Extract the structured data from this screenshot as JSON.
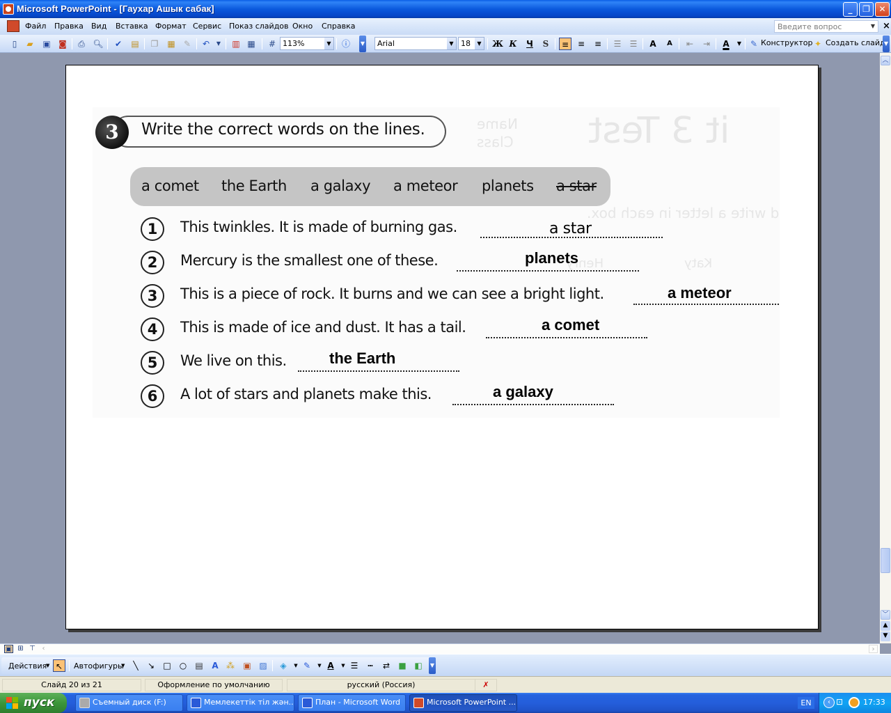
{
  "window": {
    "title": "Microsoft PowerPoint - [Гаухар Ашык сабак]",
    "buttons": {
      "minimize": "_",
      "restore": "❐",
      "close": "✕"
    }
  },
  "menu": {
    "items": [
      "Файл",
      "Правка",
      "Вид",
      "Вставка",
      "Формат",
      "Сервис",
      "Показ слайдов",
      "Окно",
      "Справка"
    ],
    "help_placeholder": "Введите вопрос"
  },
  "toolbar": {
    "zoom": "113%",
    "font": "Arial",
    "font_size": "18",
    "bold": "Ж",
    "italic": "К",
    "underline": "Ч",
    "shadow": "S",
    "designer": "Конструктор",
    "new_slide": "Создать слайд",
    "icons": [
      "new-icon",
      "open-icon",
      "save-icon",
      "permission-icon",
      "print-icon",
      "print-preview-icon",
      "spelling-icon",
      "research-icon",
      "copy-icon",
      "paste-icon",
      "format-painter-icon",
      "undo-icon",
      "chart-icon",
      "table-icon",
      "grid-icon",
      "help-icon"
    ]
  },
  "slide": {
    "exercise_number": "3",
    "exercise_title": "Write the correct words on the lines.",
    "word_bank": [
      {
        "text": "a comet",
        "struck": false
      },
      {
        "text": "the Earth",
        "struck": false
      },
      {
        "text": "a galaxy",
        "struck": false
      },
      {
        "text": "a meteor",
        "struck": false
      },
      {
        "text": "planets",
        "struck": false
      },
      {
        "text": "a star",
        "struck": true
      }
    ],
    "questions": [
      {
        "number": "1",
        "text": "This twinkles. It is made of burning gas.",
        "answer": "a star",
        "answer_printed": true
      },
      {
        "number": "2",
        "text": "Mercury is the smallest one of these.",
        "answer": "planets",
        "answer_printed": false
      },
      {
        "number": "3",
        "text": "This is a piece of rock. It burns and we can see a bright light.",
        "answer": "a meteor",
        "answer_printed": false
      },
      {
        "number": "4",
        "text": "This is made of ice and dust. It has a tail.",
        "answer": "a comet",
        "answer_printed": false
      },
      {
        "number": "5",
        "text": "We live on this.",
        "answer": "the Earth",
        "answer_printed": false
      },
      {
        "number": "6",
        "text": "A lot of stars and planets make this.",
        "answer": "a galaxy",
        "answer_printed": false
      }
    ],
    "background_ghost_text": {
      "heading": "it 3 Test",
      "name_label": "Name",
      "class_label": "Class",
      "instruction": "What are they going to do? Listen and write a letter in each box.",
      "names": [
        "Katy",
        "Henry"
      ]
    }
  },
  "drawing_toolbar": {
    "actions": "Действия",
    "autoshapes": "Автофигуры"
  },
  "status": {
    "slide": "Слайд 20 из 21",
    "design": "Оформление по умолчанию",
    "language": "русский (Россия)"
  },
  "taskbar": {
    "start": "пуск",
    "tasks": [
      {
        "label": "Съемный диск (F:)",
        "active": false
      },
      {
        "label": "Мемлекеттік тіл жән...",
        "active": false
      },
      {
        "label": "План - Microsoft Word",
        "active": false
      },
      {
        "label": "Microsoft PowerPoint ...",
        "active": true
      }
    ],
    "lang": "EN",
    "clock": "17:33"
  }
}
